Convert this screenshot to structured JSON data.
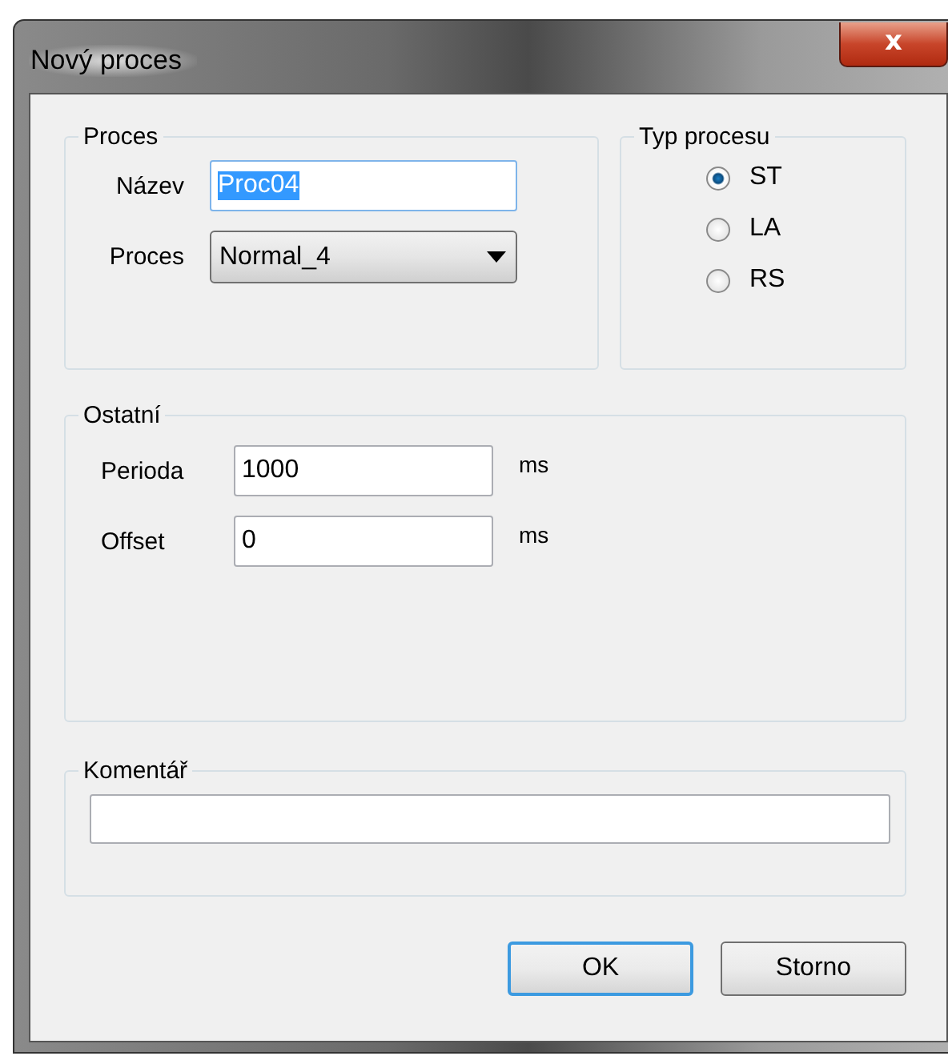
{
  "window": {
    "title": "Nový proces",
    "close": "x"
  },
  "proces_group": {
    "title": "Proces",
    "name_label": "Název",
    "name_value": "Proc04",
    "name_text_selected": true,
    "process_label": "Proces",
    "process_value": "Normal_4"
  },
  "typ_group": {
    "title": "Typ procesu",
    "options": [
      {
        "label": "ST",
        "selected": true
      },
      {
        "label": "LA",
        "selected": false
      },
      {
        "label": "RS",
        "selected": false
      }
    ]
  },
  "ostatni_group": {
    "title": "Ostatní",
    "fields": [
      {
        "label": "Perioda",
        "value": "1000",
        "unit": "ms"
      },
      {
        "label": "Offset",
        "value": "0",
        "unit": "ms"
      }
    ]
  },
  "comment_group": {
    "title": "Komentář"
  },
  "buttons": [
    {
      "label": "OK",
      "default": true
    },
    {
      "label": "Storno",
      "default": false
    }
  ]
}
